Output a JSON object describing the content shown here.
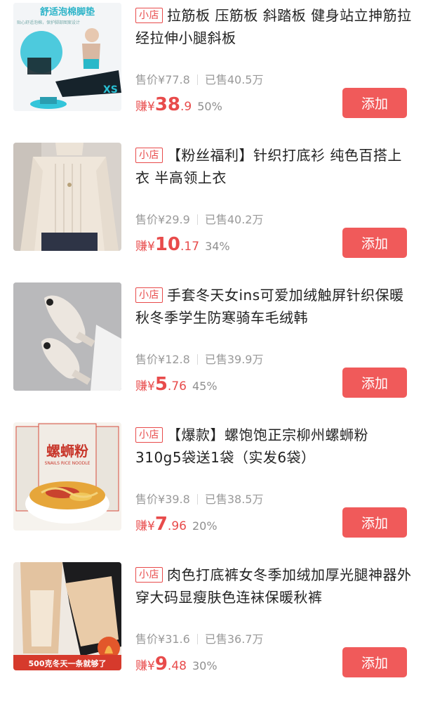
{
  "products": [
    {
      "tag": "小店",
      "title": "拉筋板 压筋板 斜踏板 健身站立抻筋拉经拉伸小腿斜板",
      "price_label": "售价",
      "price": "¥77.8",
      "sold_label": "已售",
      "sold": "40.5万",
      "earn_label": "赚¥",
      "earn_int": "38",
      "earn_dec": ".9",
      "rate": "50%",
      "add_label": "添加",
      "image_caption": "舒适泡棉脚垫",
      "image_subcaption": "贴心舒适泡棉，保护脚部图案设计",
      "image_shirt_text": "XS"
    },
    {
      "tag": "小店",
      "title": "【粉丝福利】针织打底衫 纯色百搭上衣 半高领上衣",
      "price_label": "售价",
      "price": "¥29.9",
      "sold_label": "已售",
      "sold": "40.2万",
      "earn_label": "赚¥",
      "earn_int": "10",
      "earn_dec": ".17",
      "rate": "34%",
      "add_label": "添加"
    },
    {
      "tag": "小店",
      "title": "手套冬天女ins可爱加绒触屏针织保暖秋冬季学生防寒骑车毛绒韩",
      "price_label": "售价",
      "price": "¥12.8",
      "sold_label": "已售",
      "sold": "39.9万",
      "earn_label": "赚¥",
      "earn_int": "5",
      "earn_dec": ".76",
      "rate": "45%",
      "add_label": "添加"
    },
    {
      "tag": "小店",
      "title": "【爆款】螺饱饱正宗柳州螺蛳粉310g5袋送1袋（实发6袋）",
      "price_label": "售价",
      "price": "¥39.8",
      "sold_label": "已售",
      "sold": "38.5万",
      "earn_label": "赚¥",
      "earn_int": "7",
      "earn_dec": ".96",
      "rate": "20%",
      "add_label": "添加",
      "image_caption": "螺蛳粉",
      "image_subcaption": "SNAILS RICE NOODLE"
    },
    {
      "tag": "小店",
      "title": "肉色打底裤女冬季加绒加厚光腿神器外穿大码显瘦肤色连袜保暖秋裤",
      "price_label": "售价",
      "price": "¥31.6",
      "sold_label": "已售",
      "sold": "36.7万",
      "earn_label": "赚¥",
      "earn_int": "9",
      "earn_dec": ".48",
      "rate": "30%",
      "add_label": "添加",
      "image_caption": "500克冬天一条就够了"
    }
  ]
}
